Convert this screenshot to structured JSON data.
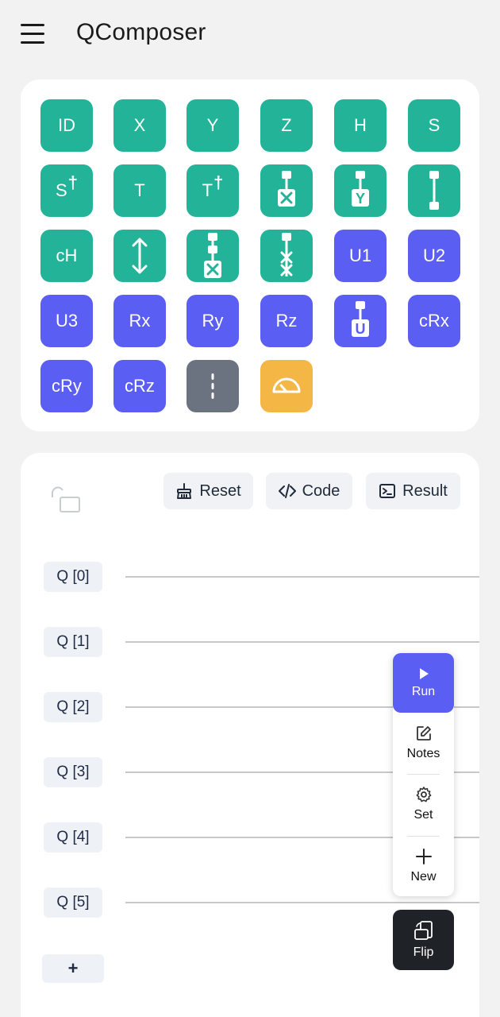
{
  "app": {
    "title": "QComposer"
  },
  "palette": {
    "gates": [
      {
        "label": "ID",
        "color": "#23b398"
      },
      {
        "label": "X",
        "color": "#23b398"
      },
      {
        "label": "Y",
        "color": "#23b398"
      },
      {
        "label": "Z",
        "color": "#23b398"
      },
      {
        "label": "H",
        "color": "#23b398"
      },
      {
        "label": "S",
        "color": "#23b398"
      },
      {
        "label": "S",
        "sup": "†",
        "color": "#23b398"
      },
      {
        "label": "T",
        "color": "#23b398"
      },
      {
        "label": "T",
        "sup": "†",
        "color": "#23b398"
      },
      {
        "icon": "cx-gate-icon",
        "color": "#23b398"
      },
      {
        "icon": "cy-gate-icon",
        "glyph": "Y",
        "color": "#23b398"
      },
      {
        "icon": "cz-gate-icon",
        "color": "#23b398"
      },
      {
        "label": "cH",
        "color": "#23b398"
      },
      {
        "icon": "swap-gate-icon",
        "color": "#23b398"
      },
      {
        "icon": "ccx-gate-icon",
        "color": "#23b398"
      },
      {
        "icon": "cswap-gate-icon",
        "color": "#23b398"
      },
      {
        "label": "U1",
        "color": "#5b5ef2"
      },
      {
        "label": "U2",
        "color": "#5b5ef2"
      },
      {
        "label": "U3",
        "color": "#5b5ef2"
      },
      {
        "label": "Rx",
        "color": "#5b5ef2"
      },
      {
        "label": "Ry",
        "color": "#5b5ef2"
      },
      {
        "label": "Rz",
        "color": "#5b5ef2"
      },
      {
        "icon": "cu-gate-icon",
        "glyph": "U",
        "color": "#5b5ef2"
      },
      {
        "label": "cRx",
        "color": "#5b5ef2"
      },
      {
        "label": "cRy",
        "color": "#5b5ef2"
      },
      {
        "label": "cRz",
        "color": "#5b5ef2"
      },
      {
        "icon": "barrier-icon",
        "color": "#6b7380"
      },
      {
        "icon": "measure-gauge-icon",
        "color": "#f4b746"
      }
    ]
  },
  "toolbar": {
    "reset_label": "Reset",
    "code_label": "Code",
    "result_label": "Result"
  },
  "qubits": [
    "Q [0]",
    "Q [1]",
    "Q [2]",
    "Q [3]",
    "Q [4]",
    "Q [5]"
  ],
  "add_qubit_label": "+",
  "fab": {
    "run_label": "Run",
    "notes_label": "Notes",
    "set_label": "Set",
    "new_label": "New",
    "flip_label": "Flip"
  }
}
